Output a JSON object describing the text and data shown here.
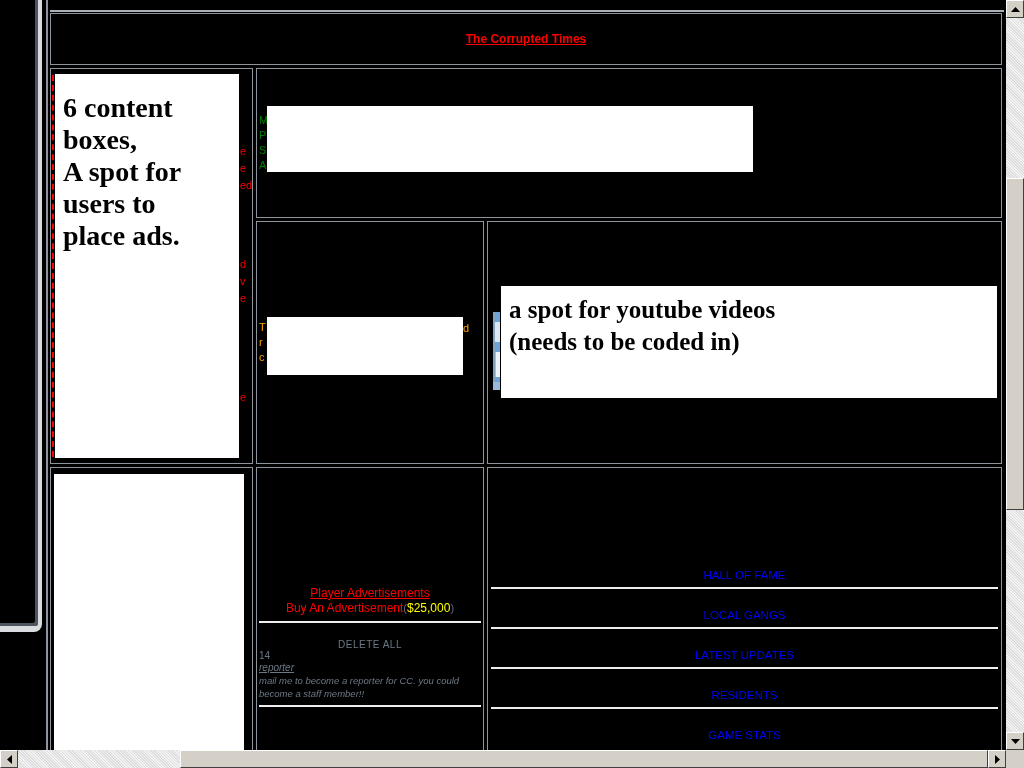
{
  "header": {
    "title": "The Corrupted Times"
  },
  "ad_column": {
    "note_lines": [
      "6 content",
      "boxes,",
      "A spot for",
      "users to",
      "place ads."
    ],
    "edge_letters": [
      "e",
      "e",
      "ed",
      "d",
      "v",
      "e",
      "e"
    ]
  },
  "news_box": {
    "edge_letters": [
      "M",
      "P",
      "S",
      "A"
    ]
  },
  "info_box": {
    "edge_letters": [
      "T",
      "r",
      "c"
    ],
    "right_letter": "d"
  },
  "video_box": {
    "note_lines": [
      "a spot for youtube videos",
      "(needs to be coded in)"
    ]
  },
  "advertisements": {
    "title": "Player Advertisements",
    "buy_label": "Buy An Advertisement",
    "open_paren": "(",
    "price": "$25,000",
    "close_paren": ")",
    "delete_all": "DELETE ALL",
    "ads": [
      {
        "id_text": "14",
        "author": "reporter",
        "message": "mail me to become a reporter for CC. you could become a staff member!!"
      }
    ]
  },
  "nav_links": [
    "HALL OF FAME",
    "LOCAL GANGS",
    "LATEST UPDATES",
    "RESIDENTS",
    "GAME STATS"
  ]
}
